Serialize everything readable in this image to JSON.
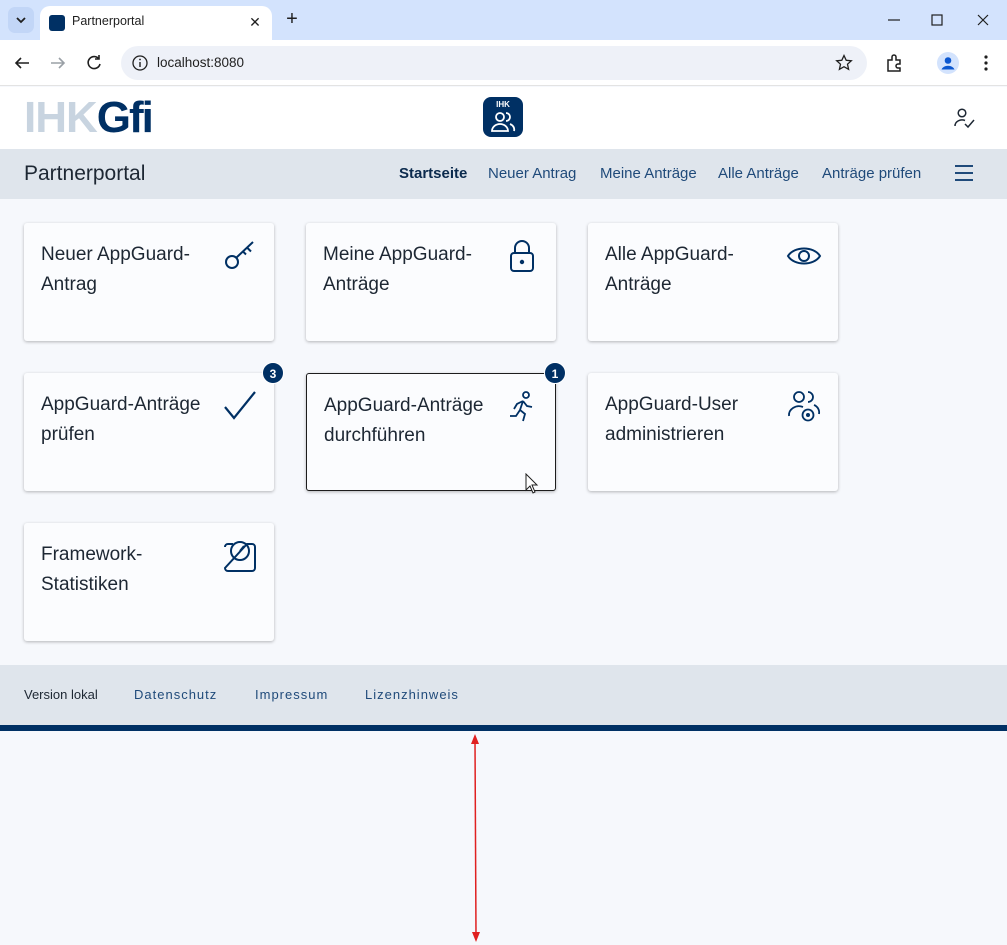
{
  "browser": {
    "tab_title": "Partnerportal",
    "url": "localhost:8080"
  },
  "header": {
    "brand_ihk": "IHK",
    "brand_gfi": "Gfi",
    "badge_text": "IHK"
  },
  "nav": {
    "title": "Partnerportal",
    "links": [
      "Startseite",
      "Neuer Antrag",
      "Meine Anträge",
      "Alle Anträge",
      "Anträge prüfen"
    ]
  },
  "cards": [
    {
      "title": "Neuer AppGuard-Antrag",
      "icon": "key-icon"
    },
    {
      "title": "Meine AppGuard-Anträge",
      "icon": "lock-icon"
    },
    {
      "title": "Alle AppGuard-Anträge",
      "icon": "eye-icon"
    },
    {
      "title": "AppGuard-Anträge prüfen",
      "icon": "checkmark-icon",
      "badge": "3"
    },
    {
      "title": "AppGuard-Anträge durchführen",
      "icon": "running-person-icon",
      "badge": "1"
    },
    {
      "title": "AppGuard-User administrieren",
      "icon": "users-gear-icon"
    },
    {
      "title": "Framework-Statistiken",
      "icon": "gauge-icon"
    }
  ],
  "footer": {
    "version": "Version lokal",
    "links": [
      "Datenschutz",
      "Impressum",
      "Lizenzhinweis"
    ]
  },
  "colors": {
    "primary": "#003064",
    "nav_bg": "#dfe5ec",
    "annotation": "#e02020"
  }
}
